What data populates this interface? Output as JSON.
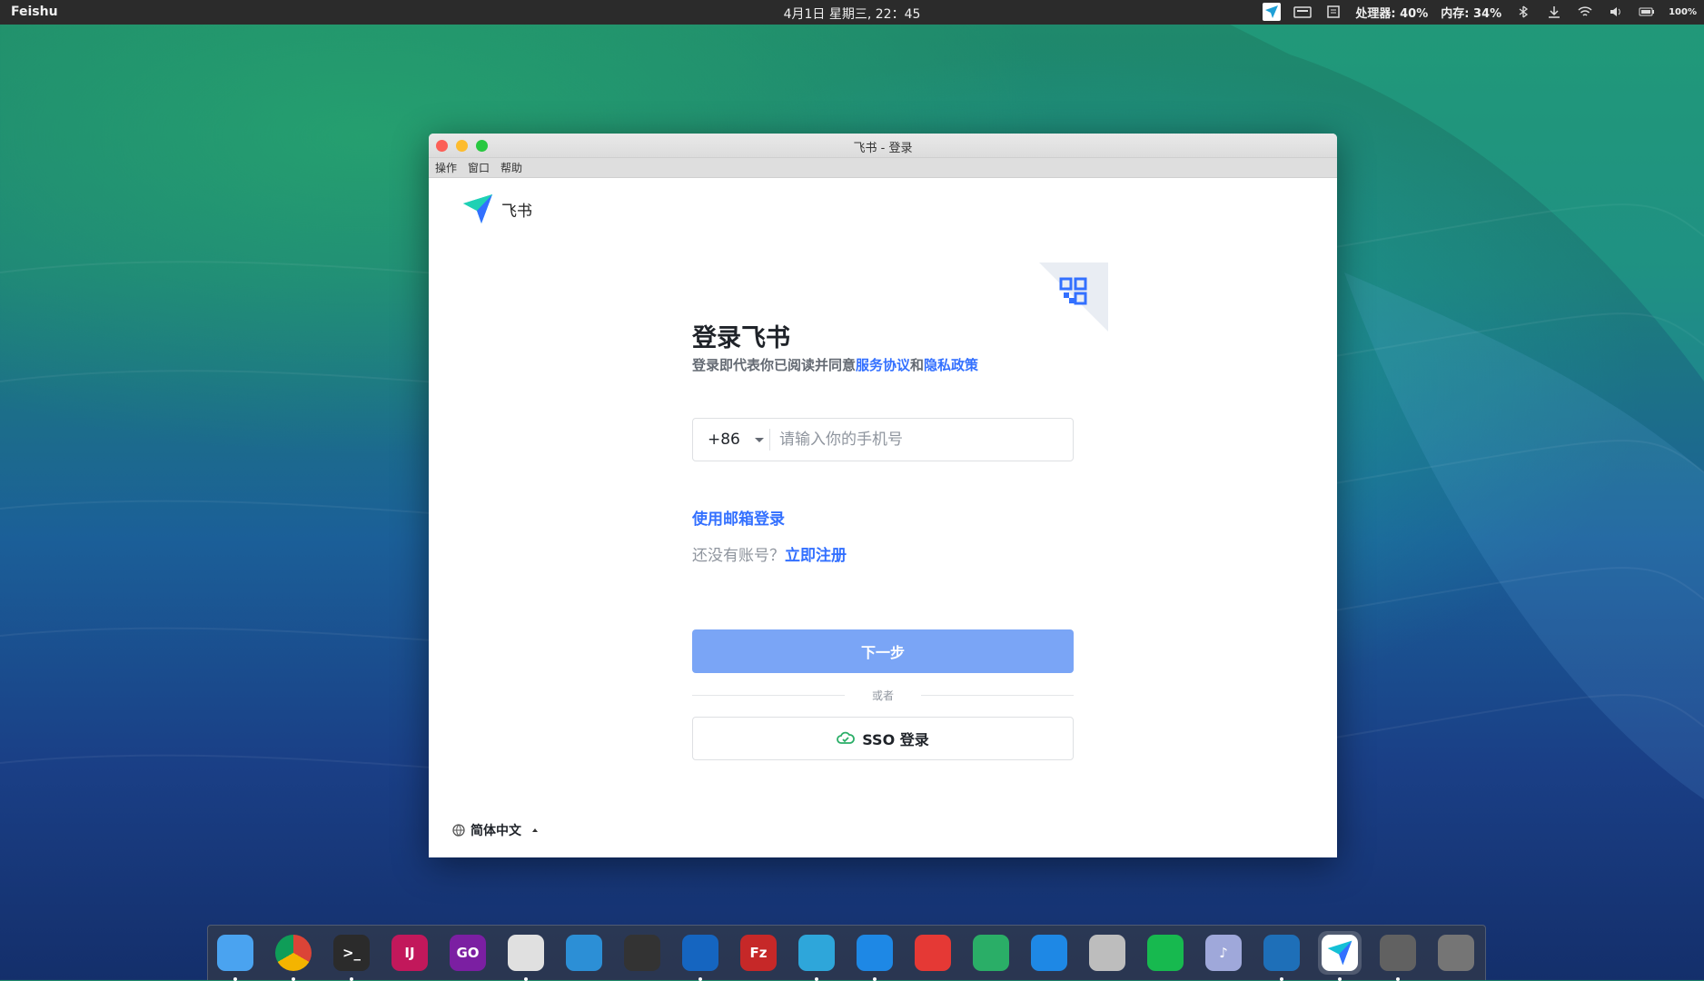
{
  "topbar": {
    "app_name": "Feishu",
    "clock": "4月1日 星期三, 22：45",
    "cpu": "处理器: 40%",
    "mem": "内存: 34%",
    "battery": "100%"
  },
  "window": {
    "title": "飞书 - 登录",
    "menu": [
      "操作",
      "窗口",
      "帮助"
    ]
  },
  "login": {
    "brand": "飞书",
    "heading": "登录飞书",
    "agree_prefix": "登录即代表你已阅读并同意",
    "terms_link": "服务协议",
    "and": "和",
    "privacy_link": "隐私政策",
    "country_code": "+86",
    "phone_placeholder": "请输入你的手机号",
    "email_login": "使用邮箱登录",
    "no_account": "还没有账号？",
    "register_link": "立即注册",
    "next_button": "下一步",
    "or_text": "或者",
    "sso_button": "SSO 登录",
    "language": "简体中文"
  },
  "dock": {
    "items": [
      {
        "name": "finder",
        "label": "",
        "color": "#4aa3f0"
      },
      {
        "name": "chrome",
        "label": "",
        "color": "#e8e8e8"
      },
      {
        "name": "terminal",
        "label": ">_",
        "color": "#2b2b2b"
      },
      {
        "name": "intellij",
        "label": "IJ",
        "color": "#c2185b"
      },
      {
        "name": "goland",
        "label": "GO",
        "color": "#7b1fa2"
      },
      {
        "name": "vscode",
        "label": "",
        "color": "#e0e0e0"
      },
      {
        "name": "mysql-workbench",
        "label": "",
        "color": "#2c8fd6"
      },
      {
        "name": "db-tool",
        "label": "",
        "color": "#333333"
      },
      {
        "name": "sogou",
        "label": "",
        "color": "#1565c0"
      },
      {
        "name": "filezilla",
        "label": "Fz",
        "color": "#c62828"
      },
      {
        "name": "telegram",
        "label": "",
        "color": "#2ea6da"
      },
      {
        "name": "lark-mail",
        "label": "",
        "color": "#1e88e5"
      },
      {
        "name": "netease-music",
        "label": "",
        "color": "#e53935"
      },
      {
        "name": "wechat",
        "label": "",
        "color": "#2aae67"
      },
      {
        "name": "dingtalk",
        "label": "",
        "color": "#1e88e5"
      },
      {
        "name": "disk-tool",
        "label": "",
        "color": "#bdbdbd"
      },
      {
        "name": "mini-program",
        "label": "",
        "color": "#17b94f"
      },
      {
        "name": "music",
        "label": "♪",
        "color": "#9fa8da"
      },
      {
        "name": "install-tool",
        "label": "",
        "color": "#1e6fb8"
      },
      {
        "name": "feishu",
        "label": "",
        "color": "#ffffff"
      },
      {
        "name": "settings",
        "label": "",
        "color": "#616161"
      },
      {
        "name": "launcher",
        "label": "",
        "color": "#757575"
      }
    ]
  }
}
